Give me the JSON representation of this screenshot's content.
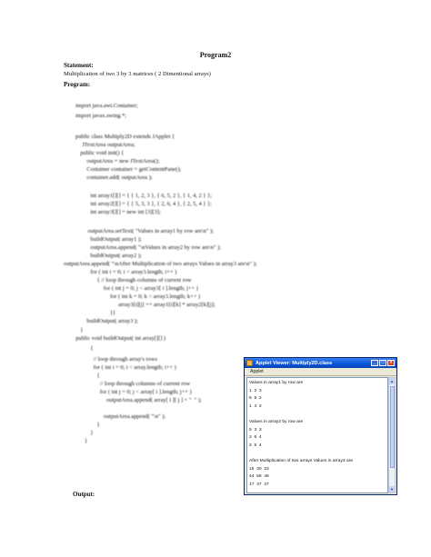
{
  "document": {
    "title": "Program2",
    "statement_heading": "Statement:",
    "statement_text": "Multiplication of two 3 by 3 matrices ( 2 Dimentional arrays)",
    "program_heading": "Program:",
    "output_heading": "Output:",
    "code_lines": [
      "import java.awt.Container;",
      "import javax.swing.*;",
      "",
      "public class Multiply2D extends JApplet {",
      "  JTextArea outputArea;",
      "  public void init() {",
      "    outputArea = new JTextArea();",
      "    Container container = getContentPane();",
      "    container.add( outputArea );",
      "",
      "    int array1[][] = { { 1, 2, 3 }, { 6, 5, 2 }, { 1, 4, 2 } };",
      "    int array2[][] = { { 5, 3, 3 }, { 2, 6, 4 }, { 2, 5, 4 } };",
      "    int array3[][] = new int [3][3];",
      "",
      "    outputArea.setText( \"Values in array1 by row are\\n\" );",
      "    buildOutput( array1 );",
      "    outputArea.append( \"\\nValues in array2 by row are\\n\" );",
      "    buildOutput( array2 );",
      "outputArea.append( \"\\nAfter Multiplication of two arrays Values in array3 are\\n\" );",
      "    for ( int i = 0; i < array3.length; i++ )",
      "      { // loop through columns of current row",
      "        for ( int j = 0; j < array3[ i ].length; j++ )",
      "          for ( int k = 0; k < array3.length; k++ )",
      "            array3[i][j] += array1[i][k] * array2[k][j];",
      "          }}",
      "    buildOutput( array3 );",
      "  }",
      "  public void buildOutput( int array[][] )",
      "    {",
      "      // loop through array's rows",
      "      for ( int i = 0; i < array.length; i++ )",
      "      {",
      "        // loop through columns of current row",
      "        for ( int j = 0; j < array[ i ].length; j++ )",
      "          outputArea.append( array[ i ][ j ] + \"  \" );",
      "",
      "        outputArea.append( \"\\n\" );",
      "      }",
      "    }",
      "}"
    ]
  },
  "applet_window": {
    "title": "Applet Viewer: Multiply2D.class",
    "menu_label": "Applet",
    "output_lines": [
      "Values in array1 by row are",
      "1  2  3",
      "6  5  2",
      "1  4  2",
      "",
      "Values in array2 by row are",
      "5  3  3",
      "2  6  4",
      "2  5  4",
      "",
      "After Multiplication of two arrays Values in array3 are",
      "15  30  23",
      "44  58  46",
      "17  37  27"
    ]
  }
}
